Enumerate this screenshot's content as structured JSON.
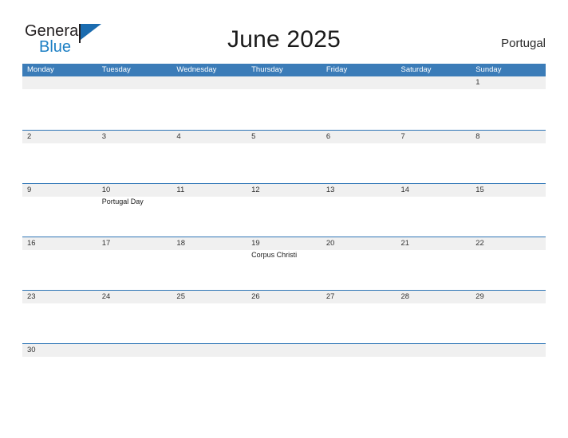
{
  "brand": {
    "name_part1": "General",
    "name_part2": "Blue",
    "flag_icon": "triangle-flag-icon"
  },
  "header": {
    "title": "June 2025",
    "country": "Portugal"
  },
  "colors": {
    "header_blue": "#3b7cb8",
    "rule_blue": "#2e75b6",
    "band_gray": "#f0f0f0",
    "logo_blue": "#1c7fc4",
    "text_dark": "#231f20"
  },
  "calendar": {
    "weekdays": [
      "Monday",
      "Tuesday",
      "Wednesday",
      "Thursday",
      "Friday",
      "Saturday",
      "Sunday"
    ],
    "weeks": [
      [
        {
          "day": "",
          "events": []
        },
        {
          "day": "",
          "events": []
        },
        {
          "day": "",
          "events": []
        },
        {
          "day": "",
          "events": []
        },
        {
          "day": "",
          "events": []
        },
        {
          "day": "",
          "events": []
        },
        {
          "day": "1",
          "events": []
        }
      ],
      [
        {
          "day": "2",
          "events": []
        },
        {
          "day": "3",
          "events": []
        },
        {
          "day": "4",
          "events": []
        },
        {
          "day": "5",
          "events": []
        },
        {
          "day": "6",
          "events": []
        },
        {
          "day": "7",
          "events": []
        },
        {
          "day": "8",
          "events": []
        }
      ],
      [
        {
          "day": "9",
          "events": []
        },
        {
          "day": "10",
          "events": [
            "Portugal Day"
          ]
        },
        {
          "day": "11",
          "events": []
        },
        {
          "day": "12",
          "events": []
        },
        {
          "day": "13",
          "events": []
        },
        {
          "day": "14",
          "events": []
        },
        {
          "day": "15",
          "events": []
        }
      ],
      [
        {
          "day": "16",
          "events": []
        },
        {
          "day": "17",
          "events": []
        },
        {
          "day": "18",
          "events": []
        },
        {
          "day": "19",
          "events": [
            "Corpus Christi"
          ]
        },
        {
          "day": "20",
          "events": []
        },
        {
          "day": "21",
          "events": []
        },
        {
          "day": "22",
          "events": []
        }
      ],
      [
        {
          "day": "23",
          "events": []
        },
        {
          "day": "24",
          "events": []
        },
        {
          "day": "25",
          "events": []
        },
        {
          "day": "26",
          "events": []
        },
        {
          "day": "27",
          "events": []
        },
        {
          "day": "28",
          "events": []
        },
        {
          "day": "29",
          "events": []
        }
      ],
      [
        {
          "day": "30",
          "events": []
        },
        {
          "day": "",
          "events": []
        },
        {
          "day": "",
          "events": []
        },
        {
          "day": "",
          "events": []
        },
        {
          "day": "",
          "events": []
        },
        {
          "day": "",
          "events": []
        },
        {
          "day": "",
          "events": []
        }
      ]
    ]
  }
}
